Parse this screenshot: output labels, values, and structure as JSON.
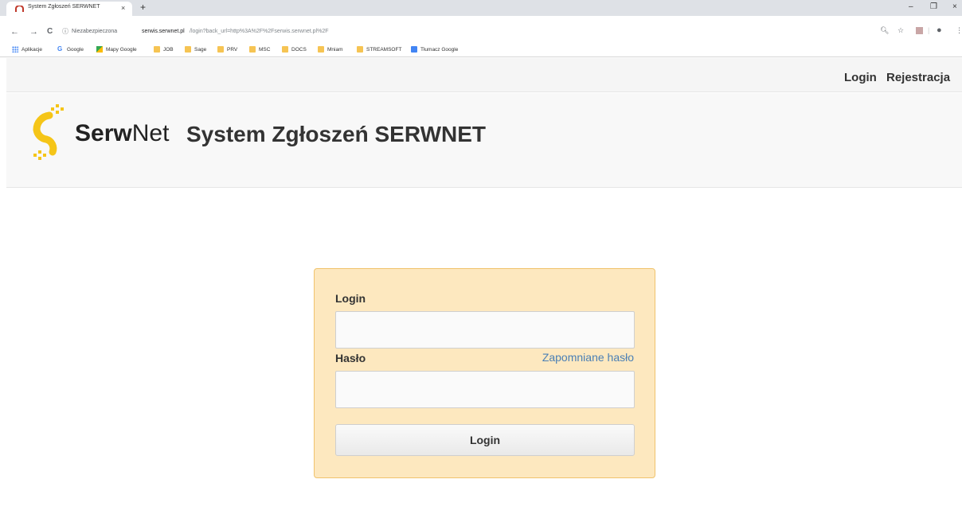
{
  "browser": {
    "tab_title": "System Zgłoszeń SERWNET",
    "tab_close": "×",
    "new_tab": "+",
    "window_controls": [
      "–",
      "❐",
      "×"
    ],
    "nav": {
      "back": "←",
      "forward": "→",
      "reload": "C"
    },
    "url_security": "Niezabezpieczona",
    "url_host": "serwis.serwnet.pl",
    "url_rest": "/login?back_url=http%3A%2F%2Fserwis.serwnet.pl%2F",
    "bookmarks": [
      {
        "label": "Aplikacje",
        "icon": "apps-grid-icon"
      },
      {
        "label": "Google",
        "icon": "google-icon"
      },
      {
        "label": "Mapy Google",
        "icon": "maps-icon"
      },
      {
        "label": "JOB",
        "icon": "folder-icon"
      },
      {
        "label": "Sage",
        "icon": "folder-icon"
      },
      {
        "label": "PRV",
        "icon": "folder-icon"
      },
      {
        "label": "MSC",
        "icon": "folder-icon"
      },
      {
        "label": "DOCS",
        "icon": "folder-icon"
      },
      {
        "label": "Mniam",
        "icon": "folder-icon"
      },
      {
        "label": "STREAMSOFT",
        "icon": "folder-icon"
      },
      {
        "label": "Tłumacz Google",
        "icon": "translate-icon"
      }
    ]
  },
  "topnav": {
    "login": "Login",
    "register": "Rejestracja"
  },
  "header": {
    "logo_bold": "Serw",
    "logo_light": "Net",
    "title": "System Zgłoszeń SERWNET"
  },
  "form": {
    "login_label": "Login",
    "login_value": "",
    "password_label": "Hasło",
    "password_value": "",
    "forgot_link": "Zapomniane hasło",
    "submit_label": "Login"
  },
  "colors": {
    "brand_yellow": "#f5c518",
    "panel_bg": "#fde8bf",
    "link": "#4a7fb5"
  }
}
